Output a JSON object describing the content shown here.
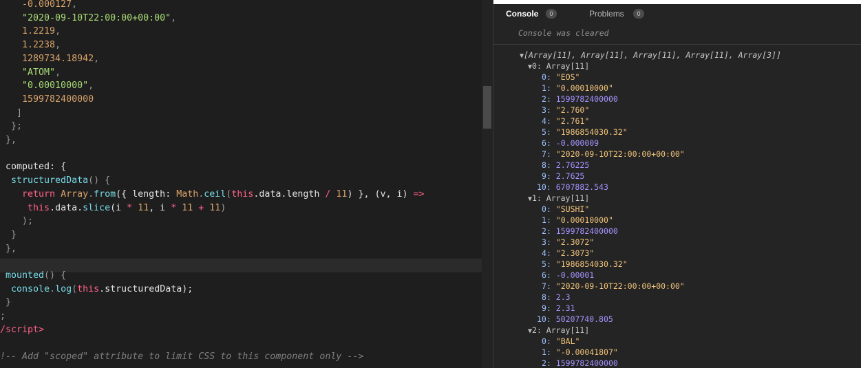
{
  "editor": {
    "lines": [
      [
        {
          "t": "    -0.000127",
          "c": "c-num"
        },
        {
          "t": ",",
          "c": "c-pun"
        }
      ],
      [
        {
          "t": "    \"2020-09-10T22:00:00+00:00\"",
          "c": "c-str"
        },
        {
          "t": ",",
          "c": "c-pun"
        }
      ],
      [
        {
          "t": "    1.2219",
          "c": "c-num"
        },
        {
          "t": ",",
          "c": "c-pun"
        }
      ],
      [
        {
          "t": "    1.2238",
          "c": "c-num"
        },
        {
          "t": ",",
          "c": "c-pun"
        }
      ],
      [
        {
          "t": "    1289734.18942",
          "c": "c-num"
        },
        {
          "t": ",",
          "c": "c-pun"
        }
      ],
      [
        {
          "t": "    \"ATOM\"",
          "c": "c-str"
        },
        {
          "t": ",",
          "c": "c-pun"
        }
      ],
      [
        {
          "t": "    \"0.00010000\"",
          "c": "c-str"
        },
        {
          "t": ",",
          "c": "c-pun"
        }
      ],
      [
        {
          "t": "    1599782400000",
          "c": "c-num"
        }
      ],
      [
        {
          "t": "   ]",
          "c": "c-pun"
        }
      ],
      [
        {
          "t": "  };",
          "c": "c-pun"
        }
      ],
      [
        {
          "t": " },",
          "c": "c-pun"
        }
      ],
      [
        {
          "t": "",
          "c": "c-pun"
        }
      ],
      [
        {
          "t": " computed: {",
          "c": "c-prop"
        }
      ],
      [
        {
          "t": "  structuredData",
          "c": "c-fn"
        },
        {
          "t": "() {",
          "c": "c-pun"
        }
      ],
      [
        {
          "t": "    return ",
          "c": "c-kw"
        },
        {
          "t": "Array",
          "c": "c-num"
        },
        {
          "t": ".",
          "c": "c-pun"
        },
        {
          "t": "from",
          "c": "c-fn"
        },
        {
          "t": "({ length: ",
          "c": "c-prop"
        },
        {
          "t": "Math",
          "c": "c-num"
        },
        {
          "t": ".",
          "c": "c-pun"
        },
        {
          "t": "ceil",
          "c": "c-fn"
        },
        {
          "t": "(",
          "c": "c-pun"
        },
        {
          "t": "this",
          "c": "c-this"
        },
        {
          "t": ".data.length ",
          "c": "c-prop"
        },
        {
          "t": "/ ",
          "c": "c-kw"
        },
        {
          "t": "11",
          "c": "c-num"
        },
        {
          "t": ") }, (v, i) ",
          "c": "c-prop"
        },
        {
          "t": "=>",
          "c": "c-kw"
        }
      ],
      [
        {
          "t": "     ",
          "c": "c-pun"
        },
        {
          "t": "this",
          "c": "c-this"
        },
        {
          "t": ".data.",
          "c": "c-prop"
        },
        {
          "t": "slice",
          "c": "c-fn"
        },
        {
          "t": "(i ",
          "c": "c-prop"
        },
        {
          "t": "* ",
          "c": "c-kw"
        },
        {
          "t": "11",
          "c": "c-num"
        },
        {
          "t": ", i ",
          "c": "c-prop"
        },
        {
          "t": "* ",
          "c": "c-kw"
        },
        {
          "t": "11 ",
          "c": "c-num"
        },
        {
          "t": "+ ",
          "c": "c-kw"
        },
        {
          "t": "11",
          "c": "c-num"
        },
        {
          "t": ")",
          "c": "c-pun"
        }
      ],
      [
        {
          "t": "    );",
          "c": "c-pun"
        }
      ],
      [
        {
          "t": "  }",
          "c": "c-pun"
        }
      ],
      [
        {
          "t": " },",
          "c": "c-pun"
        }
      ],
      [
        {
          "t": "",
          "c": "c-pun"
        }
      ],
      [
        {
          "t": " mounted",
          "c": "c-fn"
        },
        {
          "t": "() {",
          "c": "c-pun"
        }
      ],
      [
        {
          "t": "  console",
          "c": "c-fn"
        },
        {
          "t": ".",
          "c": "c-pun"
        },
        {
          "t": "log",
          "c": "c-fn"
        },
        {
          "t": "(",
          "c": "c-pun"
        },
        {
          "t": "this",
          "c": "c-this"
        },
        {
          "t": ".structuredData);",
          "c": "c-prop"
        }
      ],
      [
        {
          "t": " }",
          "c": "c-pun"
        }
      ],
      [
        {
          "t": ";",
          "c": "c-pun"
        }
      ],
      [
        {
          "t": "/script>",
          "c": "c-tag"
        }
      ],
      [
        {
          "t": "",
          "c": "c-pun"
        }
      ],
      [
        {
          "t": "!-- Add \"scoped\" attribute to limit CSS to this component only -->",
          "c": "c-cmt"
        }
      ]
    ]
  },
  "devtools": {
    "tabs": [
      {
        "label": "Console",
        "badge": "0",
        "active": true
      },
      {
        "label": "Problems",
        "badge": "0",
        "active": false
      }
    ],
    "cleared_message": "Console was cleared",
    "root_summary": "[Array[11], Array[11], Array[11], Array[11], Array[3]]",
    "groups": [
      {
        "header": "0: Array[11]",
        "items": [
          {
            "k": "0",
            "v": "\"EOS\"",
            "t": "s"
          },
          {
            "k": "1",
            "v": "\"0.00010000\"",
            "t": "s"
          },
          {
            "k": "2",
            "v": "1599782400000",
            "t": "n"
          },
          {
            "k": "3",
            "v": "\"2.760\"",
            "t": "s"
          },
          {
            "k": "4",
            "v": "\"2.761\"",
            "t": "s"
          },
          {
            "k": "5",
            "v": "\"1986854030.32\"",
            "t": "s"
          },
          {
            "k": "6",
            "v": "-0.000009",
            "t": "n"
          },
          {
            "k": "7",
            "v": "\"2020-09-10T22:00:00+00:00\"",
            "t": "s"
          },
          {
            "k": "8",
            "v": "2.76225",
            "t": "n"
          },
          {
            "k": "9",
            "v": "2.7625",
            "t": "n"
          },
          {
            "k": "10",
            "v": "6707882.543",
            "t": "n"
          }
        ]
      },
      {
        "header": "1: Array[11]",
        "items": [
          {
            "k": "0",
            "v": "\"SUSHI\"",
            "t": "s"
          },
          {
            "k": "1",
            "v": "\"0.00010000\"",
            "t": "s"
          },
          {
            "k": "2",
            "v": "1599782400000",
            "t": "n"
          },
          {
            "k": "3",
            "v": "\"2.3072\"",
            "t": "s"
          },
          {
            "k": "4",
            "v": "\"2.3073\"",
            "t": "s"
          },
          {
            "k": "5",
            "v": "\"1986854030.32\"",
            "t": "s"
          },
          {
            "k": "6",
            "v": "-0.00001",
            "t": "n"
          },
          {
            "k": "7",
            "v": "\"2020-09-10T22:00:00+00:00\"",
            "t": "s"
          },
          {
            "k": "8",
            "v": "2.3",
            "t": "n"
          },
          {
            "k": "9",
            "v": "2.31",
            "t": "n"
          },
          {
            "k": "10",
            "v": "50207740.805",
            "t": "n"
          }
        ]
      },
      {
        "header": "2: Array[11]",
        "items": [
          {
            "k": "0",
            "v": "\"BAL\"",
            "t": "s"
          },
          {
            "k": "1",
            "v": "\"-0.00041807\"",
            "t": "s"
          },
          {
            "k": "2",
            "v": "1599782400000",
            "t": "n"
          }
        ]
      }
    ]
  }
}
